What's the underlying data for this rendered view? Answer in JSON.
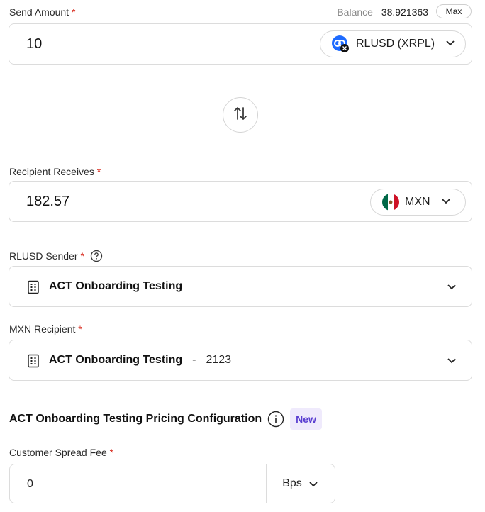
{
  "send": {
    "label": "Send Amount",
    "required_mark": "*",
    "balance_label": "Balance",
    "balance_value": "38.921363",
    "max_label": "Max",
    "amount": "10",
    "currency": "RLUSD (XRPL)"
  },
  "swap": {
    "icon": "swap-arrows-icon"
  },
  "receive": {
    "label": "Recipient Receives",
    "required_mark": "*",
    "amount": "182.57",
    "currency": "MXN"
  },
  "sender": {
    "label": "RLUSD Sender",
    "required_mark": "*",
    "value": "ACT Onboarding Testing"
  },
  "recipient": {
    "label": "MXN Recipient",
    "required_mark": "*",
    "value": "ACT Onboarding Testing",
    "separator": "-",
    "account": "2123"
  },
  "pricing": {
    "title": "ACT Onboarding Testing Pricing Configuration",
    "badge": "New"
  },
  "fee": {
    "label": "Customer Spread Fee",
    "required_mark": "*",
    "value": "0",
    "unit": "Bps"
  },
  "colors": {
    "accent_purple": "#5b3fd1",
    "badge_bg": "#efeafc",
    "required_red": "#d92d20",
    "border": "#dcdcdc"
  }
}
